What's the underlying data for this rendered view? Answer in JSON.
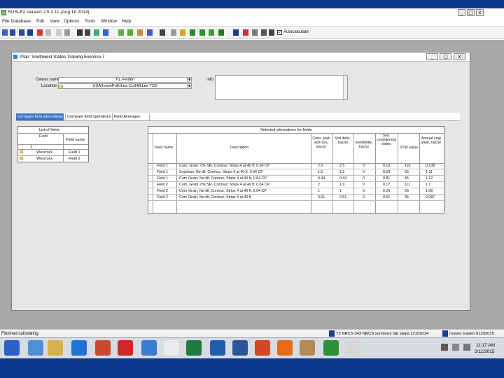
{
  "app": {
    "title": "RUSLE2 Version 2.5.2.11 (Aug 18 2014)",
    "window_controls": [
      "_",
      "□",
      "x"
    ]
  },
  "menu": [
    "File",
    "Database",
    "Edit",
    "View",
    "Options",
    "Tools",
    "Window",
    "Help"
  ],
  "toolbar": {
    "autocalc_label": "Autocalculate",
    "autocalc_checked": "✓"
  },
  "plan_window": {
    "title": "Plan: Southwest States Training Exercise 7",
    "controls": [
      "_",
      "□",
      "x"
    ],
    "owner_label": "Owner name",
    "owner_value": "Tu, Feiden",
    "location_label": "Location",
    "location_value": "USA\\Iowa\\Polk\\Lea Co\\Hill\\Lee TD5",
    "info_label": "Info",
    "tabs": [
      "Compare field alternatives",
      "Compare field operations",
      "Field Averages"
    ]
  },
  "fields_grid": {
    "title": "List of fields",
    "col_field": "Field",
    "col_field_name": "Field name",
    "header_value": "1",
    "rows": [
      {
        "field": "Wesrrock",
        "name": "Field 1"
      },
      {
        "field": "Wesrrock",
        "name": "Field 2"
      }
    ]
  },
  "alternatives_grid": {
    "title": "Selected alternatives for fields",
    "columns": [
      "Field name",
      "Description",
      "Cons. plan soil loss, t/ac/yr",
      "Soil deliv., t/ac/yr",
      "Erodibility, t/ac/yr",
      "Sed. conditioning index",
      "STIR value",
      "Annual crop yield, t/ac/yr"
    ],
    "rows": [
      {
        "field": "Field 1",
        "desc": "Corn, Grain; 0% SR, Contour; Strips 4 at 40 ft; 0.04 CP",
        "c1": "2.5",
        "c2": "2.5",
        "c3": "0",
        "c4": "0.13",
        "c5": "110",
        "c6": "0.108"
      },
      {
        "field": "Field 1",
        "desc": "Soybean; No-till; Contour; Strips 4 at 40 ft; 0.04 CP",
        "c1": "1.5",
        "c2": "1.5",
        "c3": "0",
        "c4": "0.29",
        "c5": "66",
        "c6": "1.11"
      },
      {
        "field": "Field 1",
        "desc": "Corn Grain; No-till; Contour; Strips 4 at 40 ft; 0.04 CP",
        "c1": "0.44",
        "c2": "0.44",
        "c3": "0",
        "c4": "0.81",
        "c5": "45",
        "c6": "1.12"
      },
      {
        "field": "Field 2",
        "desc": "Corn, Grain; 0% SR, Contour; Strips 4 at 40 ft; 0.04 CP",
        "c1": "2",
        "c2": "1.9",
        "c3": "0",
        "c4": "0.17",
        "c5": "111",
        "c6": "1.1"
      },
      {
        "field": "Field 2",
        "desc": "Corn Grain; No-till; Contour; Strips 4 at 40 ft; 0.04 CP",
        "c1": "1",
        "c2": "1",
        "c3": "0",
        "c4": "0.29",
        "c5": "66",
        "c6": "1.06"
      },
      {
        "field": "Field 2",
        "desc": "Corn Grain; No-till; Contour; Strips 4 at 40 ft",
        "c1": "0.61",
        "c2": "0.61",
        "c3": "0",
        "c4": "0.61",
        "c5": "45",
        "c6": "0.087"
      }
    ]
  },
  "status_bar": {
    "text": "Finished calculating"
  },
  "taskbar": {
    "item_1": "T2 NRCS 343 NRCS summary tab steps 12152014",
    "item_2": "moses master 01292015",
    "time": "11:17 AM",
    "date": "2/11/2015"
  }
}
